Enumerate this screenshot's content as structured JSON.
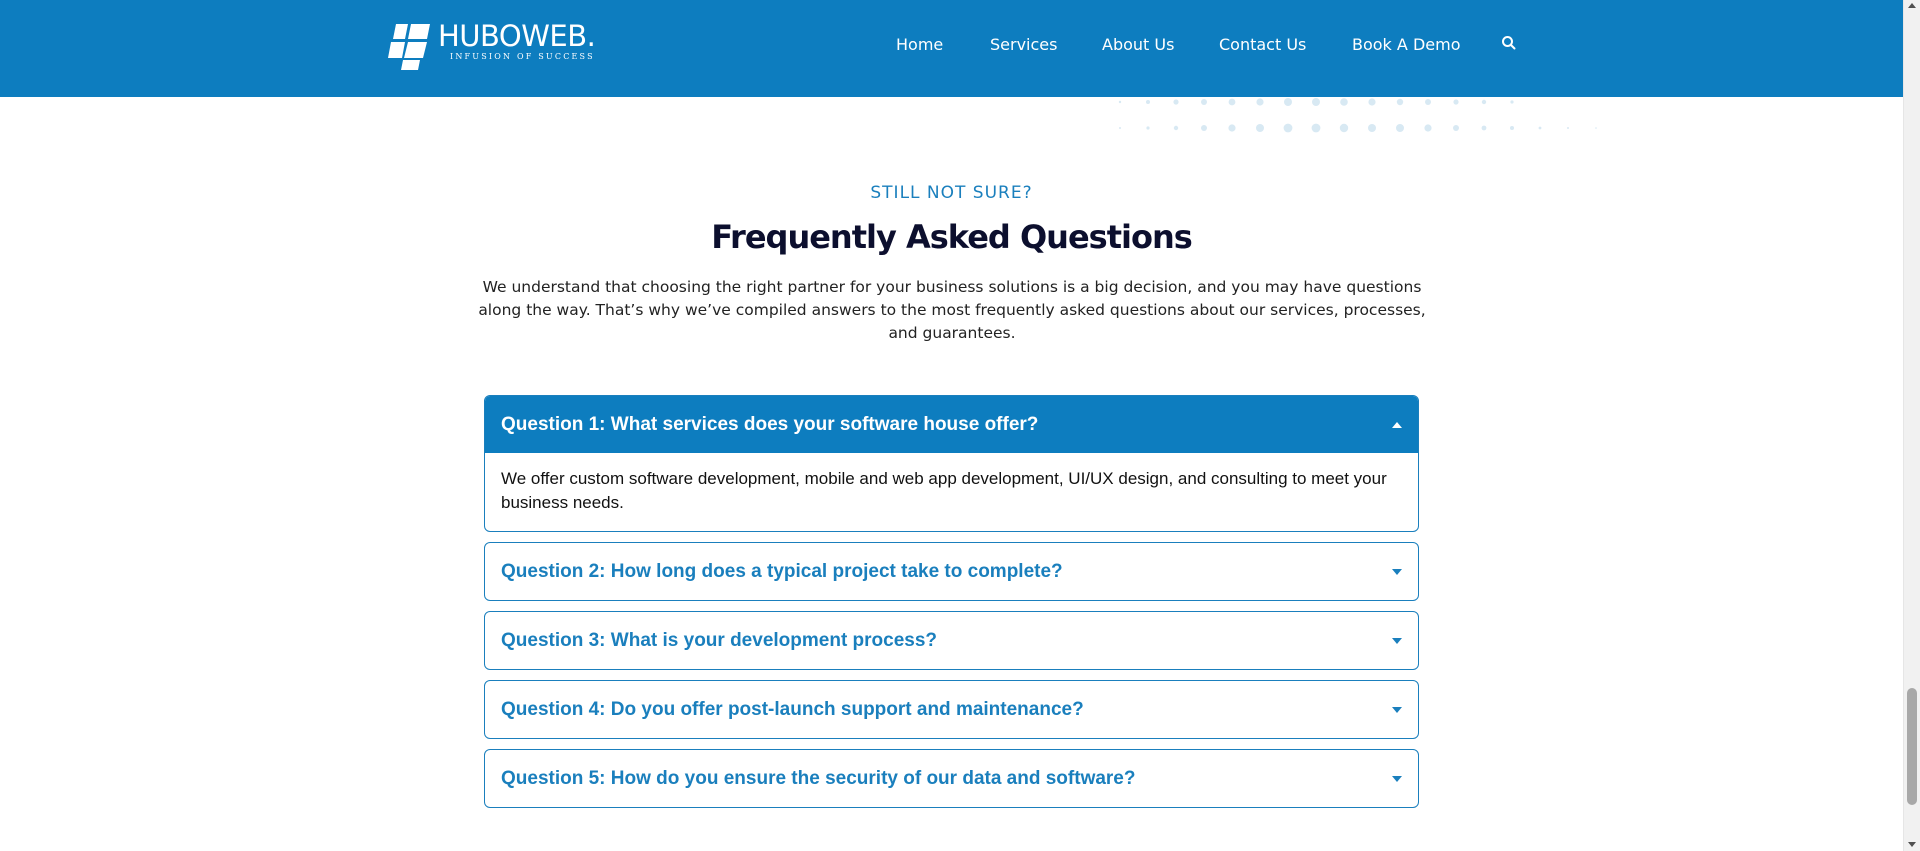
{
  "header": {
    "logo": {
      "name": "HUBOWEB.",
      "tagline": "INFUSION OF SUCCESS"
    },
    "nav": [
      {
        "label": "Home"
      },
      {
        "label": "Services"
      },
      {
        "label": "About Us"
      },
      {
        "label": "Contact Us"
      },
      {
        "label": "Book A Demo"
      }
    ],
    "search_icon": "search-icon"
  },
  "section": {
    "eyebrow": "STILL NOT SURE?",
    "title": "Frequently Asked Questions",
    "intro": "We understand that choosing the right partner for your business solutions is a big decision, and you may have questions along the way. That’s why we’ve compiled answers to the most frequently asked questions about our services, processes, and guarantees."
  },
  "faq": [
    {
      "question": "Question 1: What services does your software house offer?",
      "answer": "We offer custom software development, mobile and web app development, UI/UX design, and consulting to meet your business needs.",
      "expanded": true
    },
    {
      "question": "Question 2: How long does a typical project take to complete?",
      "expanded": false
    },
    {
      "question": "Question 3: What is your development process?",
      "expanded": false
    },
    {
      "question": "Question 4: Do you offer post-launch support and maintenance?",
      "expanded": false
    },
    {
      "question": "Question 5: How do you ensure the security of our data and software?",
      "expanded": false
    }
  ],
  "colors": {
    "brand": "#0d7dbf",
    "accent_text": "#1a7fbd",
    "title": "#0c0f2e"
  }
}
